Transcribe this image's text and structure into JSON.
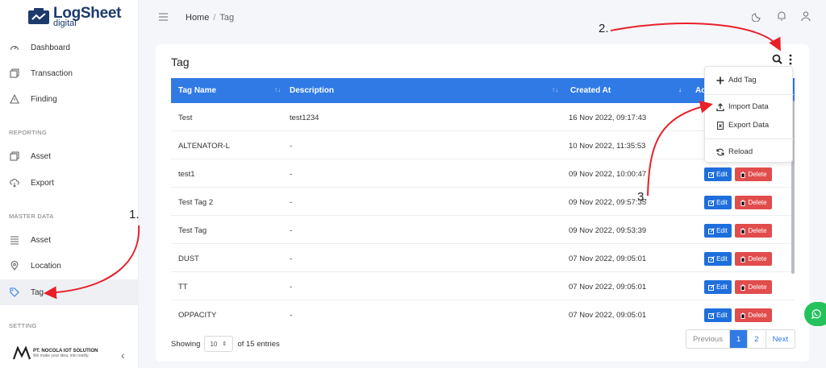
{
  "app": {
    "logo_title": "LogSheet",
    "logo_sub": "digital"
  },
  "sidebar": {
    "items_top": [
      {
        "label": "Dashboard",
        "icon": "gauge-icon"
      },
      {
        "label": "Transaction",
        "icon": "copy-icon"
      },
      {
        "label": "Finding",
        "icon": "warning-icon"
      }
    ],
    "reporting_label": "REPORTING",
    "items_reporting": [
      {
        "label": "Asset",
        "icon": "copy-icon"
      },
      {
        "label": "Export",
        "icon": "cloud-download-icon"
      }
    ],
    "master_label": "MASTER DATA",
    "items_master": [
      {
        "label": "Asset",
        "icon": "list-icon"
      },
      {
        "label": "Location",
        "icon": "map-pin-icon"
      },
      {
        "label": "Tag",
        "icon": "tag-icon",
        "active": true
      }
    ],
    "setting_label": "SETTING",
    "brand_name": "PT. NOCOLA IOT SOLUTION",
    "brand_tagline": "We make your idea, into reality."
  },
  "topbar": {
    "home": "Home",
    "separator": "/",
    "current": "Tag"
  },
  "card": {
    "title": "Tag"
  },
  "table": {
    "headers": [
      "Tag Name",
      "Description",
      "Created At",
      "Ac"
    ],
    "rows": [
      {
        "name": "Test",
        "description": "test1234",
        "created": "16 Nov 2022, 09:17:43"
      },
      {
        "name": "ALTENATOR-L",
        "description": "-",
        "created": "10 Nov 2022, 11:35:53"
      },
      {
        "name": "test1",
        "description": "-",
        "created": "09 Nov 2022, 10:00:47"
      },
      {
        "name": "Test Tag 2",
        "description": "-",
        "created": "09 Nov 2022, 09:57:35"
      },
      {
        "name": "Test Tag",
        "description": "-",
        "created": "09 Nov 2022, 09:53:39"
      },
      {
        "name": "DUST",
        "description": "-",
        "created": "07 Nov 2022, 09:05:01"
      },
      {
        "name": "TT",
        "description": "-",
        "created": "07 Nov 2022, 09:05:01"
      },
      {
        "name": "OPPACITY",
        "description": "-",
        "created": "07 Nov 2022, 09:05:01"
      }
    ],
    "edit_label": "Edit",
    "delete_label": "Delete"
  },
  "footer": {
    "showing": "Showing",
    "page_size": "10",
    "of_entries": "of 15 entries",
    "prev": "Previous",
    "page1": "1",
    "page2": "2",
    "next": "Next"
  },
  "menu": {
    "add": "Add Tag",
    "import": "Import Data",
    "export": "Export Data",
    "reload": "Reload"
  },
  "annotations": {
    "a1": "1.",
    "a2": "2.",
    "a3": "3."
  },
  "colors": {
    "primary": "#2f7ae5",
    "danger": "#e14c4c",
    "annotation_arrow": "#e8202a",
    "whatsapp": "#25c25c"
  }
}
